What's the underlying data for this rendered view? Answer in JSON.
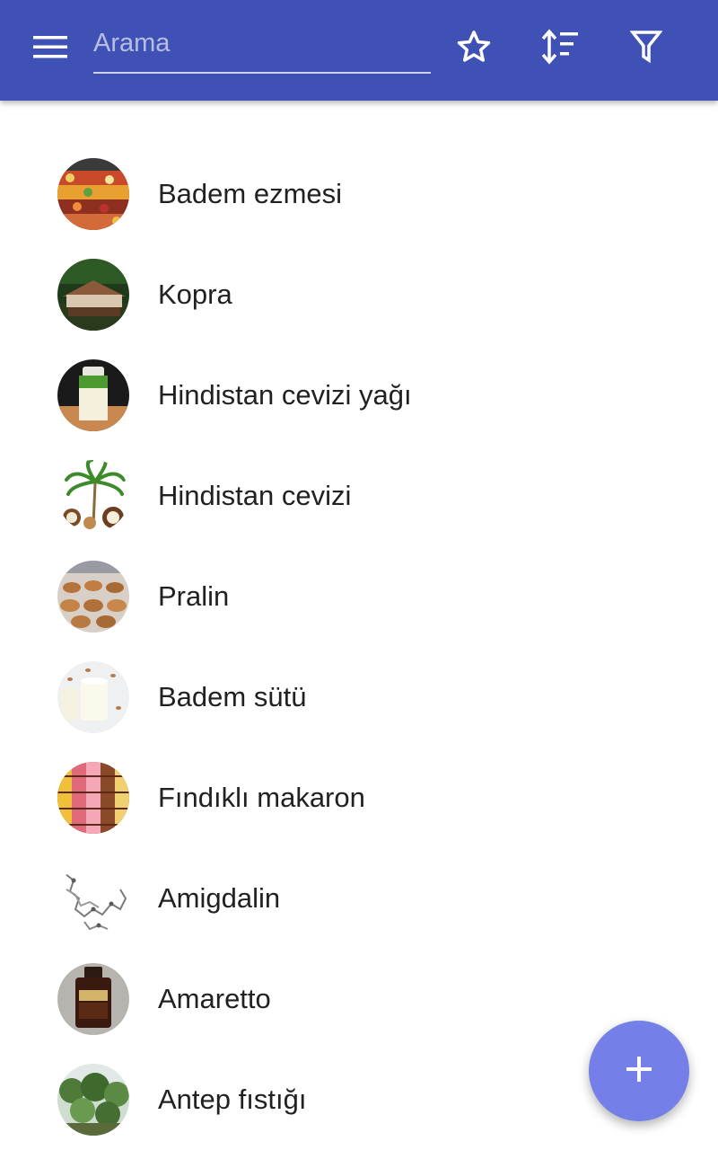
{
  "colors": {
    "toolbar": "#3F51B5",
    "fab": "#7480E8",
    "text_primary": "#212121",
    "icon": "#ffffff"
  },
  "toolbar": {
    "menu_icon": "menu-icon",
    "search": {
      "placeholder": "Arama",
      "value": ""
    },
    "favorites_icon": "star-outline-icon",
    "sort_icon": "sort-icon",
    "filter_icon": "filter-icon"
  },
  "list": {
    "items": [
      {
        "label": "Badem ezmesi",
        "image": "fruit-market-photo"
      },
      {
        "label": "Kopra",
        "image": "copra-drying-shed-photo"
      },
      {
        "label": "Hindistan cevizi yağı",
        "image": "coconut-oil-bottle-photo"
      },
      {
        "label": "Hindistan cevizi",
        "image": "coconut-palm-illustration"
      },
      {
        "label": "Pralin",
        "image": "pralines-tray-photo"
      },
      {
        "label": "Badem sütü",
        "image": "almond-milk-glasses-photo"
      },
      {
        "label": "Fındıklı makaron",
        "image": "macarons-display-photo"
      },
      {
        "label": "Amigdalin",
        "image": "molecule-structure-drawing"
      },
      {
        "label": "Amaretto",
        "image": "amaretto-bottle-photo"
      },
      {
        "label": "Antep fıstığı",
        "image": "pistachio-tree-photo"
      }
    ]
  },
  "fab": {
    "icon": "plus-icon"
  }
}
